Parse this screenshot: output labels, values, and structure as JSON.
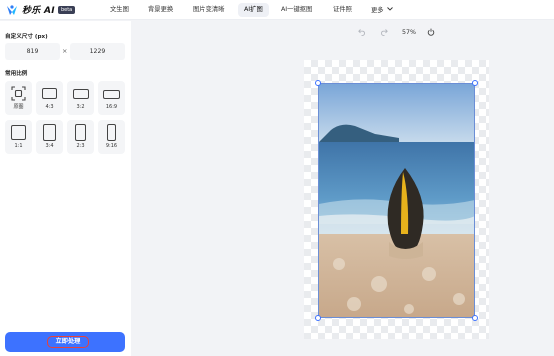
{
  "header": {
    "brand": "秒乐 AI",
    "badge": "beta",
    "nav": [
      {
        "label": "文生图"
      },
      {
        "label": "背景更换"
      },
      {
        "label": "图片变清晰"
      },
      {
        "label": "AI扩图",
        "active": true
      },
      {
        "label": "AI一键抠图"
      },
      {
        "label": "证件照"
      },
      {
        "label": "更多"
      }
    ]
  },
  "sidebar": {
    "custom_size_title": "自定义尺寸 (px)",
    "width_value": "819",
    "height_value": "1229",
    "times": "×",
    "ratio_title": "常用比例",
    "ratios": [
      {
        "label": "原图",
        "icon": "original-frame-icon"
      },
      {
        "label": "4:3",
        "icon": "ratio-4-3-icon"
      },
      {
        "label": "3:2",
        "icon": "ratio-3-2-icon"
      },
      {
        "label": "16:9",
        "icon": "ratio-16-9-icon"
      },
      {
        "label": "1:1",
        "icon": "ratio-1-1-icon"
      },
      {
        "label": "3:4",
        "icon": "ratio-3-4-icon"
      },
      {
        "label": "2:3",
        "icon": "ratio-2-3-icon"
      },
      {
        "label": "9:16",
        "icon": "ratio-9-16-icon"
      }
    ],
    "submit_label": "立即处理"
  },
  "toolbar": {
    "undo_icon": "undo-icon",
    "redo_icon": "redo-icon",
    "zoom": "57%",
    "fit_icon": "power-icon"
  },
  "colors": {
    "accent": "#3d72ff",
    "highlight": "#e8423a"
  }
}
